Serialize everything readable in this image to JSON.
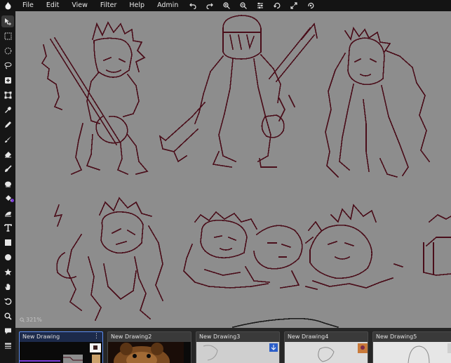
{
  "menu": {
    "items": [
      "File",
      "Edit",
      "View",
      "Filter",
      "Help",
      "Admin"
    ]
  },
  "toolbar_icons": [
    "undo-icon",
    "redo-icon",
    "zoom-in-icon",
    "zoom-out-icon",
    "adjust-icon",
    "rotate-icon",
    "fullscreen-icon",
    "resize-icon"
  ],
  "tools": [
    "move",
    "rect-select",
    "ellipse-select",
    "lasso-select",
    "crop",
    "transform",
    "eyedropper",
    "pencil",
    "brush",
    "eraser",
    "smudge",
    "blur",
    "fill",
    "gradient",
    "text",
    "rectangle",
    "ellipse",
    "star",
    "hand",
    "rotate-view",
    "zoom",
    "comment",
    "layers"
  ],
  "canvas": {
    "zoom_label": "321%",
    "art_color": "#4a0e1a",
    "background": "#8d8d8d"
  },
  "drawings": [
    {
      "title": "New Drawing",
      "active": true
    },
    {
      "title": "New Drawing2",
      "active": false
    },
    {
      "title": "New Drawing3",
      "active": false
    },
    {
      "title": "New Drawing4",
      "active": false
    },
    {
      "title": "New Drawing5",
      "active": false
    }
  ],
  "colors": {
    "accent": "#5c8ef2",
    "primary_color": "#7a3cd8"
  }
}
